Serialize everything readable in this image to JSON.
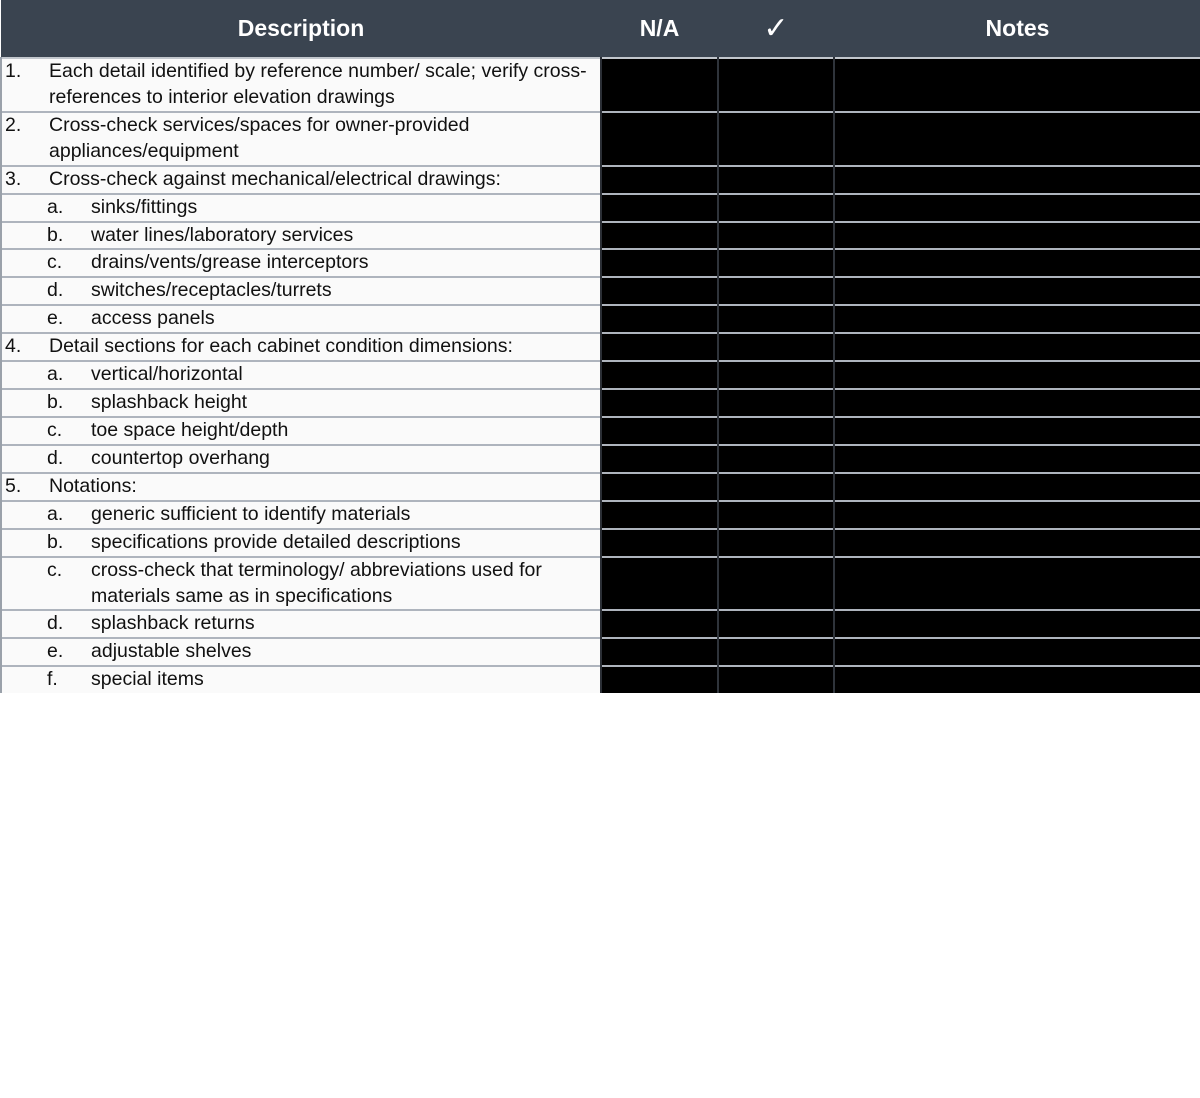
{
  "table": {
    "columns": [
      {
        "key": "description",
        "label": "Description",
        "align": "center"
      },
      {
        "key": "na",
        "label": "N/A",
        "align": "center"
      },
      {
        "key": "check",
        "label": "✓",
        "icon": "checkmark-icon",
        "align": "center"
      },
      {
        "key": "notes",
        "label": "Notes",
        "align": "center"
      }
    ],
    "colors": {
      "header_background": "#3a4450",
      "header_text": "#ffffff",
      "row_background": "#fafafa",
      "row_text": "#111111",
      "mark_cell_background": "#000000",
      "row_divider": "#aeb4bd"
    },
    "rows": [
      {
        "level": 1,
        "marker": "1.",
        "text": "Each detail identified by reference number/ scale; verify cross-references to interior elevation drawings",
        "na": "",
        "check": "",
        "notes": ""
      },
      {
        "level": 1,
        "marker": "2.",
        "text": "Cross-check services/spaces for owner-provided appliances/equipment",
        "na": "",
        "check": "",
        "notes": ""
      },
      {
        "level": 1,
        "marker": "3.",
        "text": "Cross-check against mechanical/electrical drawings:",
        "na": "",
        "check": "",
        "notes": ""
      },
      {
        "level": 2,
        "marker": "a.",
        "text": "sinks/fittings",
        "na": "",
        "check": "",
        "notes": ""
      },
      {
        "level": 2,
        "marker": "b.",
        "text": "water lines/laboratory services",
        "na": "",
        "check": "",
        "notes": ""
      },
      {
        "level": 2,
        "marker": "c.",
        "text": "drains/vents/grease interceptors",
        "na": "",
        "check": "",
        "notes": ""
      },
      {
        "level": 2,
        "marker": "d.",
        "text": "switches/receptacles/turrets",
        "na": "",
        "check": "",
        "notes": ""
      },
      {
        "level": 2,
        "marker": "e.",
        "text": "access panels",
        "na": "",
        "check": "",
        "notes": ""
      },
      {
        "level": 1,
        "marker": "4.",
        "text": "Detail sections for each cabinet condition dimensions:",
        "na": "",
        "check": "",
        "notes": ""
      },
      {
        "level": 2,
        "marker": "a.",
        "text": "vertical/horizontal",
        "na": "",
        "check": "",
        "notes": ""
      },
      {
        "level": 2,
        "marker": "b.",
        "text": "splashback height",
        "na": "",
        "check": "",
        "notes": ""
      },
      {
        "level": 2,
        "marker": "c.",
        "text": "toe space height/depth",
        "na": "",
        "check": "",
        "notes": ""
      },
      {
        "level": 2,
        "marker": "d.",
        "text": "countertop overhang",
        "na": "",
        "check": "",
        "notes": ""
      },
      {
        "level": 1,
        "marker": "5.",
        "text": "Notations:",
        "na": "",
        "check": "",
        "notes": ""
      },
      {
        "level": 2,
        "marker": "a.",
        "text": "generic sufficient to identify materials",
        "na": "",
        "check": "",
        "notes": ""
      },
      {
        "level": 2,
        "marker": "b.",
        "text": "specifications provide detailed descriptions",
        "na": "",
        "check": "",
        "notes": ""
      },
      {
        "level": 2,
        "marker": "c.",
        "text": "cross-check that terminology/ abbreviations used for materials same as in specifications",
        "na": "",
        "check": "",
        "notes": ""
      },
      {
        "level": 2,
        "marker": "d.",
        "text": "splashback returns",
        "na": "",
        "check": "",
        "notes": ""
      },
      {
        "level": 2,
        "marker": "e.",
        "text": "adjustable shelves",
        "na": "",
        "check": "",
        "notes": ""
      },
      {
        "level": 2,
        "marker": "f.",
        "text": "special items",
        "na": "",
        "check": "",
        "notes": ""
      }
    ]
  }
}
